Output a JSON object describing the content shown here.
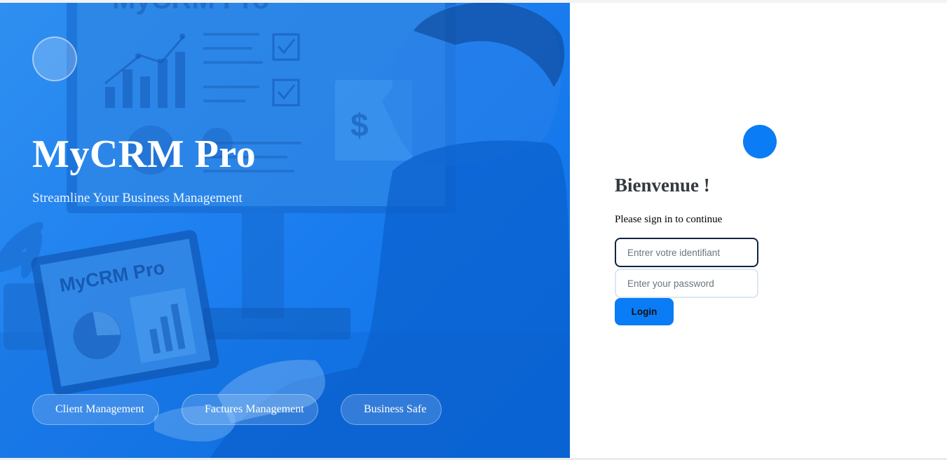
{
  "hero": {
    "title": "MyCRM Pro",
    "subtitle": "Streamline Your Business Management",
    "background_text": {
      "monitor_header": "MyCRM Pro",
      "laptop_screen": "MyCRM Pro",
      "currency_symbol": "$"
    },
    "features": [
      {
        "label": "Client Management"
      },
      {
        "label": "Factures Management"
      },
      {
        "label": "Business Safe"
      }
    ]
  },
  "login": {
    "heading": "Bienvenue !",
    "subheading": "Please sign in to continue",
    "username": {
      "placeholder": "Entrer votre identifiant",
      "value": ""
    },
    "password": {
      "placeholder": "Enter your password",
      "value": ""
    },
    "button_label": "Login"
  },
  "colors": {
    "primary": "#0a7cf5",
    "hero_blue": "#1d7ff0",
    "heading": "#343a40"
  },
  "icons": {
    "hero_logo": "circle-logo-icon",
    "login_logo": "circle-logo-icon"
  }
}
